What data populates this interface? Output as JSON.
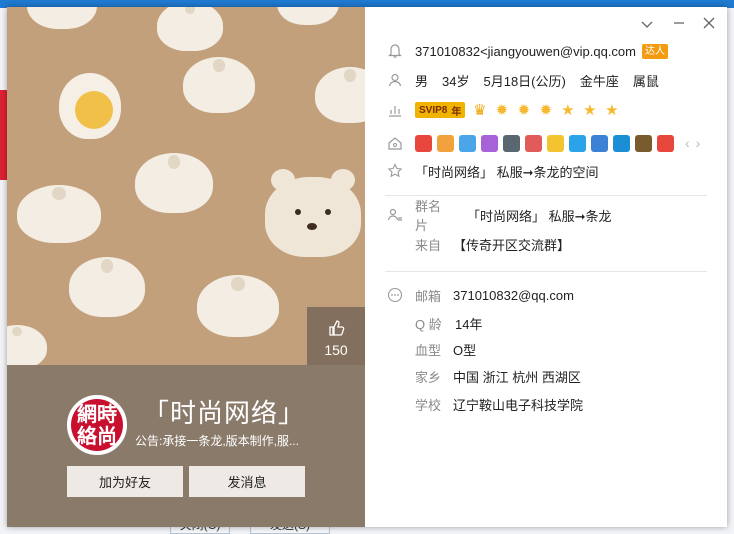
{
  "background": {
    "bottom_buttons": [
      "关闭(C)",
      "发送(S)"
    ]
  },
  "card": {
    "window_controls": [
      "chevron-down-icon",
      "minimize-icon",
      "close-icon"
    ],
    "left": {
      "likes": "150",
      "avatar_text": "網時絡尚",
      "nickname": "「时尚网络」",
      "notice": "公告:承接一条龙,版本制作,服...",
      "buttons": {
        "add_friend": "加为好友",
        "send_message": "发消息"
      }
    },
    "right": {
      "account": "371010832<jiangyouwen@vip.qq.com",
      "talent_badge": "达人",
      "gender": "男",
      "age": "34岁",
      "birthday": "5月18日(公历)",
      "zodiac": "金牛座",
      "chinese_zodiac": "属鼠",
      "svip_label": "SVIP8",
      "svip_year": "年",
      "level_icons": [
        "crown",
        "sun",
        "sun",
        "sun",
        "star",
        "star",
        "star"
      ],
      "app_icons": [
        "#e8473d",
        "#f2a23c",
        "#4aa6e8",
        "#a862d8",
        "#5b6770",
        "#e25b5b",
        "#f4c430",
        "#2aa3e8",
        "#3b82d6",
        "#1a8fd6",
        "#7a5b2e",
        "#e8473d"
      ],
      "signature": "「时尚网络」 私服➞条龙的空间",
      "group_card_label": "群名片",
      "group_card": "「时尚网络」 私服➞条龙",
      "from_label": "来自",
      "from": "【传奇开区交流群】",
      "email_label": "邮箱",
      "email": "371010832@qq.com",
      "qage_label": "Q 龄",
      "qage": "14年",
      "blood_label": "血型",
      "blood": "O型",
      "hometown_label": "家乡",
      "hometown": "中国 浙江 杭州 西湖区",
      "school_label": "学校",
      "school": "辽宁鞍山电子科技学院"
    }
  },
  "colors": {
    "accent": "#1f7ad1",
    "panel_bg": "#c3a07c",
    "band_bg": "#8a7a6a",
    "button_bg": "#eee9e4"
  }
}
